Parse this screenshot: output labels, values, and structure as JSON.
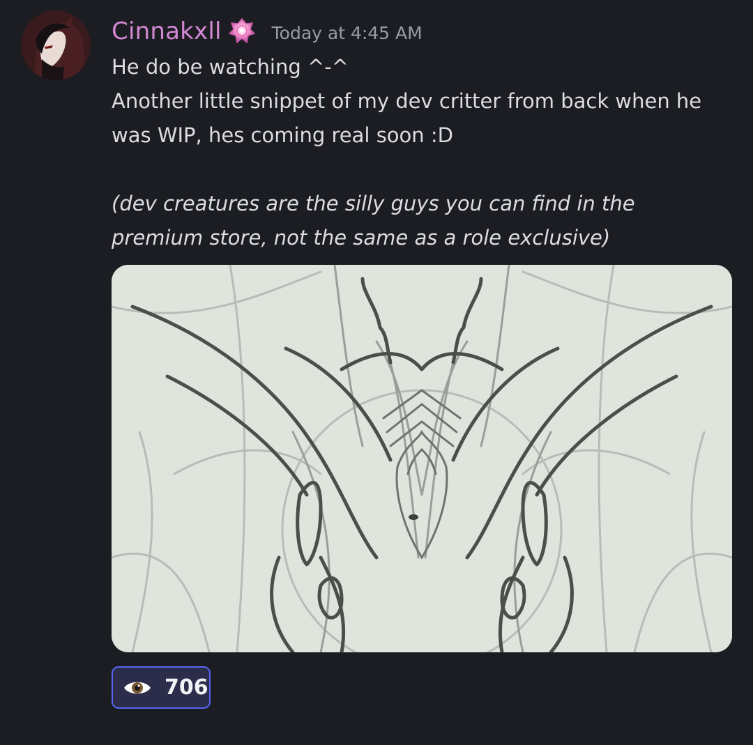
{
  "message": {
    "author": {
      "name": "Cinnakxll",
      "name_color": "#d388d4",
      "role_icon": "pink-gem-badge-icon"
    },
    "timestamp": "Today at 4:45 AM",
    "lines": [
      "He do be watching ^-^",
      "Another little snippet of my dev critter from back when he",
      "was WIP, hes coming real soon :D"
    ],
    "italic_lines": [
      "(dev creatures are the silly guys you can find in the",
      "premium store, not the same as a role exclusive)"
    ],
    "attachment": {
      "type": "image",
      "description_icon": "pencil-sketch-image"
    },
    "reactions": [
      {
        "emoji": "eye-icon",
        "count": "706",
        "active": true
      }
    ],
    "colors": {
      "background": "#1c1d22",
      "text": "#dcdde2",
      "timestamp": "#9a9ca5",
      "reaction_border": "#5865f2",
      "reaction_bg": "#2b2d4a"
    }
  }
}
